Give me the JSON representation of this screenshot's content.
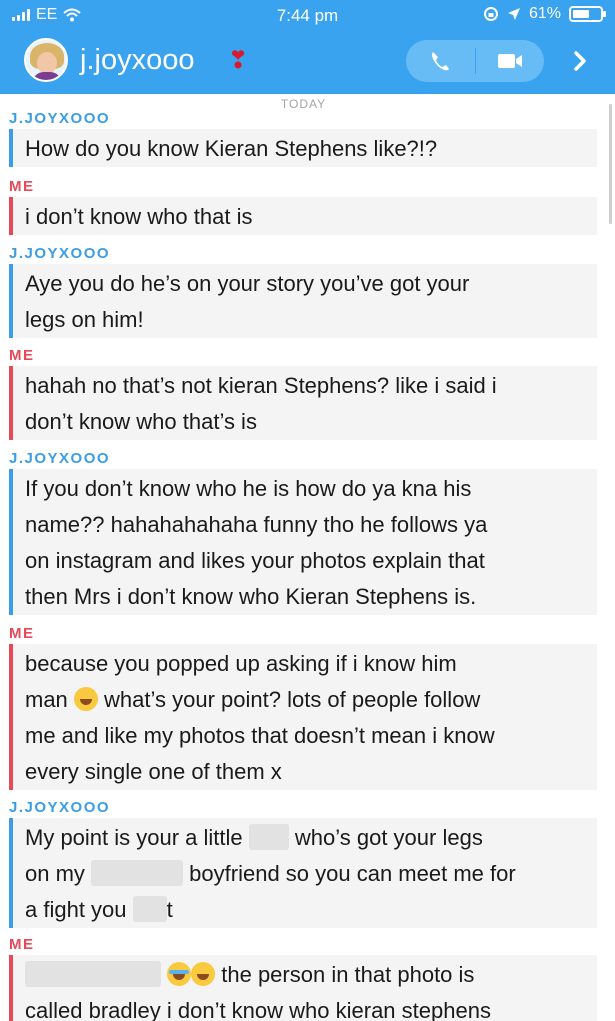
{
  "status_bar": {
    "carrier": "EE",
    "time": "7:44 pm",
    "battery": "61%",
    "battery_level": 0.61,
    "icons": [
      "signal-icon",
      "wifi-icon",
      "rotation-lock-icon",
      "location-icon",
      "battery-icon"
    ]
  },
  "header": {
    "contact_name": "j.joyxooo",
    "heart_glyph": "❣",
    "icons": [
      "avatar",
      "phone-icon",
      "video-icon",
      "chevron-right-icon"
    ],
    "colors": {
      "bar": "#3aa3f0",
      "pill": "#68bcf6"
    }
  },
  "chat": {
    "day_label": "TODAY",
    "colors": {
      "them": "#3b9de8",
      "me": "#e84858",
      "bubble": "#f4f4f4"
    },
    "messages": [
      {
        "sender": "J.JOYXOOO",
        "side": "them",
        "lines": [
          "How do you know Kieran Stephens like?!?"
        ]
      },
      {
        "sender": "ME",
        "side": "me",
        "lines": [
          "i don’t know who that is"
        ]
      },
      {
        "sender": "J.JOYXOOO",
        "side": "them",
        "lines": [
          "Aye you do he’s on your story you’ve got your",
          "legs on him!"
        ]
      },
      {
        "sender": "ME",
        "side": "me",
        "lines": [
          "hahah no that’s not kieran Stephens? like i said i",
          "don’t know who that’s is"
        ]
      },
      {
        "sender": "J.JOYXOOO",
        "side": "them",
        "lines": [
          "If you don’t know who he is how do ya kna his",
          "name?? hahahahahaha funny tho he follows ya",
          "on instagram and likes your photos explain that",
          "then Mrs i don’t know who Kieran Stephens is."
        ]
      },
      {
        "sender": "ME",
        "side": "me",
        "lines": [
          "because you popped up asking if i know him",
          "what’s your point? lots of people follow",
          "me and like my photos that doesn’t mean i know",
          "every single one of them x"
        ]
      },
      {
        "sender": "J.JOYXOOO",
        "side": "them",
        "lines": [
          "My point is your a little",
          "who’s got your legs",
          "on my",
          "boyfriend so you can meet me for",
          "a fight you",
          "t"
        ]
      },
      {
        "sender": "ME",
        "side": "me",
        "lines": [
          "the person in that photo is",
          "called bradley i don’t know who kieran stephens"
        ]
      }
    ],
    "msg6_first_word": "man"
  }
}
